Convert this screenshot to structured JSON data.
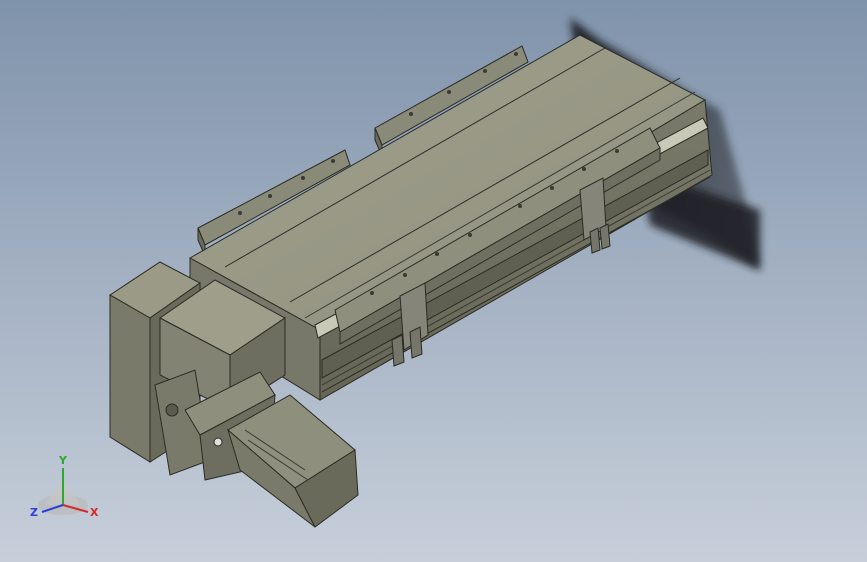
{
  "viewport": {
    "background_top": "#7f93ab",
    "background_bottom": "#c7cfda",
    "model_color": "#8c8c7a"
  },
  "model": {
    "part": "linear-actuator-stage",
    "components": [
      "base-rail",
      "carriage-rails",
      "mounting-flanges",
      "servo-motor",
      "gearbox",
      "motor-bracket"
    ]
  },
  "triad": {
    "x_label": "X",
    "y_label": "Y",
    "z_label": "Z",
    "x_color": "#d42a2a",
    "y_color": "#2ea82e",
    "z_color": "#2a3fd4"
  }
}
